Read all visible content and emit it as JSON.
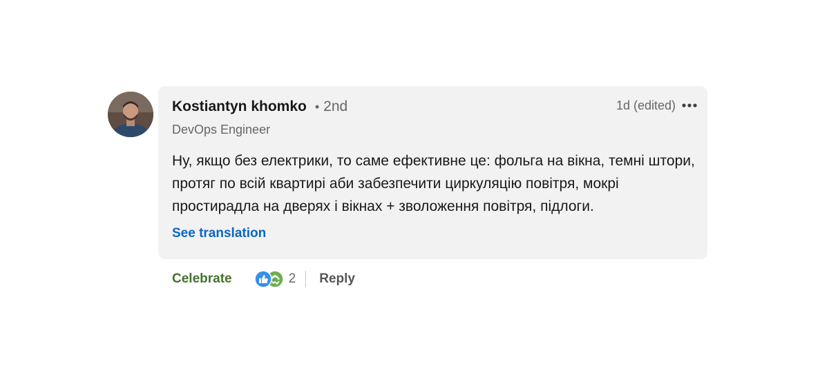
{
  "comment": {
    "author": {
      "name": "Kostiantyn khomko",
      "degree": "2nd",
      "headline": "DevOps Engineer"
    },
    "timestamp": "1d (edited)",
    "more_icon": "ellipsis-icon",
    "text": "Ну, якщо без електрики, то саме ефективне це: фольга на вікна, темні штори, протяг по всій квартирі аби забезпечити циркуляцію повітря, мокрі простирадла на дверях і вікнах + зволоження повітря, підлоги.",
    "translation_label": "See translation"
  },
  "actions": {
    "reaction_label": "Celebrate",
    "reaction_icons": [
      "like-icon",
      "celebrate-icon"
    ],
    "reaction_count": "2",
    "reply_label": "Reply"
  },
  "colors": {
    "bubble": "#f2f2f2",
    "link": "#0a66c2",
    "celebrate": "#44712e",
    "like_icon": "#378fe9",
    "celebrate_icon": "#6dae4f"
  }
}
